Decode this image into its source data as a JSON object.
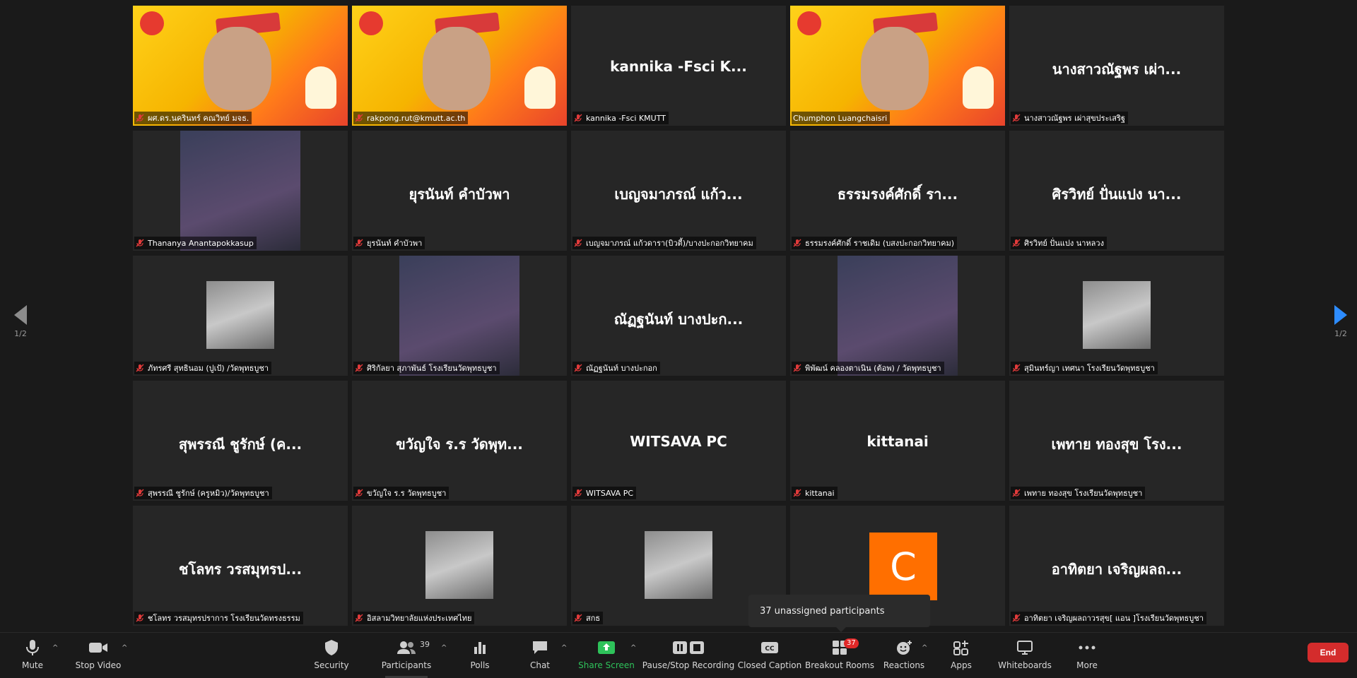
{
  "tiles": [
    {
      "big": "",
      "label": "ผศ.ดร.นครินทร์ คณวิทย์ มจธ.",
      "video": "banner"
    },
    {
      "big": "",
      "label": "rakpong.rut@kmutt.ac.th",
      "video": "banner"
    },
    {
      "big": "kannika -Fsci  K...",
      "label": "kannika -Fsci KMUTT",
      "video": "none"
    },
    {
      "big": "",
      "label": "Chumphon Luangchaisri",
      "video": "banner",
      "active": true
    },
    {
      "big": "นางสาวณัฐพร เผ่า...",
      "label": "นางสาวณัฐพร เผ่าสุขประเสริฐ",
      "video": "none"
    },
    {
      "big": "",
      "label": "Thananya Anantapokkasup",
      "video": "photo"
    },
    {
      "big": "ยุรนันท์ คำบัวพา",
      "label": "ยุรนันท์ คำบัวพา",
      "video": "none"
    },
    {
      "big": "เบญจมาภรณ์ แก้ว...",
      "label": "เบญจมาภรณ์ แก้วดารา(บิวตี้)/บางปะกอกวิทยาคม",
      "video": "none"
    },
    {
      "big": "ธรรมรงค์ศักดิ์  รา...",
      "label": "ธรรมรงค์ศักดิ์  ราชเดิม (บสงปะกอกวิทยาคม)",
      "video": "none"
    },
    {
      "big": "ศิรวิทย์ ปั่นแปง นา...",
      "label": "ศิรวิทย์ ปั่นแปง นาหลวง",
      "video": "none"
    },
    {
      "big": "",
      "label": "ภัทรศรี สุทธินอม (ปูเป้) /วัดพุทธบูชา",
      "video": "small"
    },
    {
      "big": "",
      "label": "ศิริกัลยา สุภาพันธ์ โรงเรียนวัดพุทธบูชา",
      "video": "photo"
    },
    {
      "big": "ณัฏฐนันท์ บางปะก...",
      "label": "ณัฏฐนันท์ บางปะกอก",
      "video": "none"
    },
    {
      "big": "",
      "label": "พิพัฒน์ คลองตาเนิน (ต้อพ) / วัดพุทธบูชา",
      "video": "photo"
    },
    {
      "big": "",
      "label": "สุมินทร์ญา เทศนา โรงเรียนวัดพุทธบูชา",
      "video": "small"
    },
    {
      "big": "สุพรรณี ชูรักษ์ (ค...",
      "label": "สุพรรณี ชูรักษ์ (ครูหมิว)/วัดพุทธบูชา",
      "video": "none"
    },
    {
      "big": "ขวัญใจ ร.ร วัดพุท...",
      "label": "ขวัญใจ ร.ร วัดพุทธบูชา",
      "video": "none"
    },
    {
      "big": "WITSAVA PC",
      "label": "WITSAVA PC",
      "video": "none"
    },
    {
      "big": "kittanai",
      "label": "kittanai",
      "video": "none"
    },
    {
      "big": "เพทาย ทองสุข โรง...",
      "label": "เพทาย ทองสุข โรงเรียนวัดพุทธบูชา",
      "video": "none"
    },
    {
      "big": "ชโลทร วรสมุทรป...",
      "label": "ชโลทร วรสมุทรปราการ โรงเรียนวัดทรงธรรม",
      "video": "none"
    },
    {
      "big": "",
      "label": "อิสลามวิทยาลัยแห่งประเทศไทย",
      "video": "small"
    },
    {
      "big": "",
      "label": "สกธ",
      "video": "small"
    },
    {
      "big": "",
      "label": "",
      "video": "avatar",
      "avatar": "C"
    },
    {
      "big": "อาทิตยา เจริญผลถ...",
      "label": "อาทิตยา เจริญผลถาวรสุข[ แอน ]โรงเรียนวัดพุทธบูชา",
      "video": "none"
    }
  ],
  "page_indicator_left": "1/2",
  "page_indicator_right": "1/2",
  "toolbar": {
    "mute": "Mute",
    "stop_video": "Stop Video",
    "security": "Security",
    "participants": "Participants",
    "participants_count": "39",
    "polls": "Polls",
    "chat": "Chat",
    "share_screen": "Share Screen",
    "recording": "Pause/Stop Recording",
    "closed_caption": "Closed Caption",
    "breakout_rooms": "Breakout Rooms",
    "breakout_badge": "37",
    "reactions": "Reactions",
    "apps": "Apps",
    "whiteboards": "Whiteboards",
    "more": "More",
    "end": "End"
  },
  "tooltip": "37 unassigned participants",
  "colors": {
    "accent_green": "#2ec25a",
    "active_outline": "#c8e84a",
    "end_red": "#d42c2c",
    "badge_red": "#e02828",
    "avatar_orange": "#ff6f00",
    "nav_blue": "#2d8cff"
  }
}
